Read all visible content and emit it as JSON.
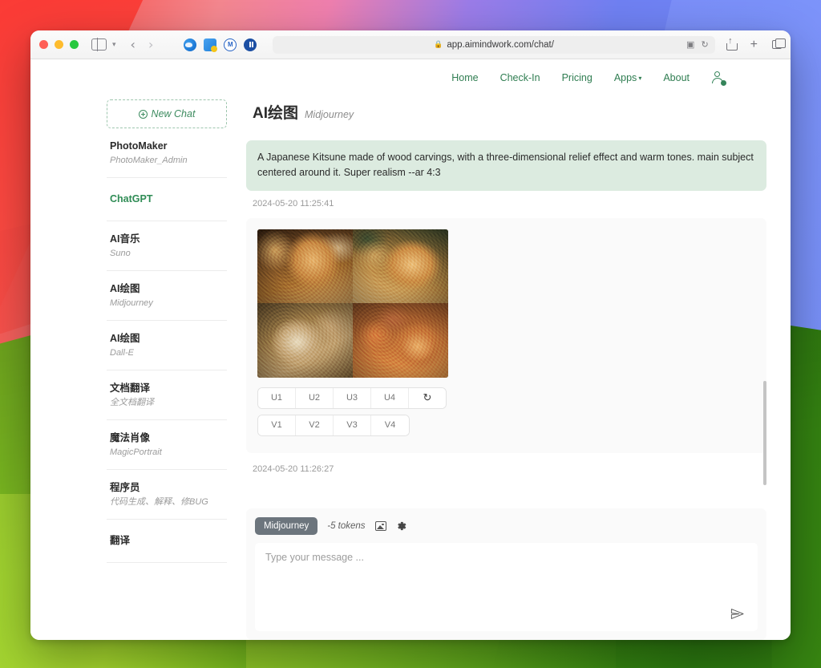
{
  "browser": {
    "url": "app.aimindwork.com/chat/",
    "lock_icon": "lock-icon",
    "reader_icon": "reader-view-icon",
    "reload_icon": "reload-icon",
    "back_icon": "back-arrow-icon",
    "forward_icon": "forward-arrow-icon",
    "sidebar_icon": "sidebar-toggle-icon",
    "share_icon": "share-icon",
    "new_tab_icon": "plus-icon",
    "tab_overview_icon": "tab-overview-icon",
    "extensions": [
      "extension-globe-icon",
      "extension-download-icon",
      "extension-m-icon",
      "extension-pause-icon"
    ]
  },
  "topnav": {
    "links": [
      {
        "label": "Home"
      },
      {
        "label": "Check-In"
      },
      {
        "label": "Pricing"
      },
      {
        "label": "Apps",
        "caret": "▾"
      },
      {
        "label": "About"
      }
    ],
    "profile_icon": "user-account-icon",
    "accent_color": "#2f7d51"
  },
  "sidebar": {
    "new_chat_label": "New Chat",
    "new_chat_icon": "plus-circle-icon",
    "items": [
      {
        "title": "PhotoMaker",
        "sub": "PhotoMaker_Admin",
        "active": false
      },
      {
        "title": "ChatGPT",
        "sub": "",
        "active": true
      },
      {
        "title": "AI音乐",
        "sub": "Suno",
        "active": false
      },
      {
        "title": "AI绘图",
        "sub": "Midjourney",
        "active": false
      },
      {
        "title": "AI绘图",
        "sub": "Dall-E",
        "active": false
      },
      {
        "title": "文档翻译",
        "sub": "全文档翻译",
        "active": false
      },
      {
        "title": "魔法肖像",
        "sub": "MagicPortrait",
        "active": false
      },
      {
        "title": "程序员",
        "sub": "代码生成、解释、修BUG",
        "active": false
      },
      {
        "title": "翻译",
        "sub": "",
        "active": false
      }
    ]
  },
  "chat": {
    "title": "AI绘图",
    "subtitle": "Midjourney",
    "user_message": "A Japanese Kitsune made of wood carvings, with a three-dimensional relief effect and warm tones. main subject centered around it. Super realism --ar 4:3",
    "user_timestamp": "2024-05-20 11:25:41",
    "bot_timestamp": "2024-05-20 11:26:27",
    "bubble_color": "#dcebe0",
    "image_alt": "2x2 grid of wood-carved kitsune fox relief images in warm amber tones",
    "upscale_buttons": [
      "U1",
      "U2",
      "U3",
      "U4"
    ],
    "variation_buttons": [
      "V1",
      "V2",
      "V3",
      "V4"
    ],
    "refresh_icon": "refresh-icon"
  },
  "composer": {
    "model_badge": "Midjourney",
    "tokens": "-5 tokens",
    "image_icon": "image-upload-icon",
    "settings_icon": "gear-icon",
    "send_icon": "send-icon",
    "placeholder": "Type your message ..."
  }
}
